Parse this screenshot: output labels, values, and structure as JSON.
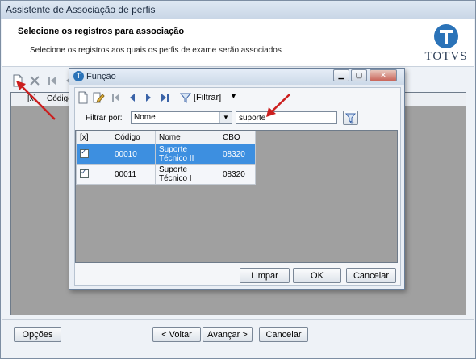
{
  "window": {
    "title": "Assistente de Associação de perfis"
  },
  "header": {
    "title": "Selecione os registros para associação",
    "subtitle": "Selecione os registros aos quais os perfis de exame serão associados",
    "logo_text": "TOTVS"
  },
  "outer_grid": {
    "col_check": "[x]",
    "col_code": "Código"
  },
  "footer": {
    "options_label": "Opções",
    "back_label": "< Voltar",
    "next_label": "Avançar >",
    "cancel_label": "Cancelar"
  },
  "dialog": {
    "title": "Função",
    "filter_menu_label": "[Filtrar]",
    "filter_by_label": "Filtrar por:",
    "filter_field_value": "Nome",
    "search_value": "suporte",
    "columns": [
      "[x]",
      "Código",
      "Nome",
      "CBO"
    ],
    "rows": [
      {
        "code": "00010",
        "name": "Suporte Técnico II",
        "cbo": "08320"
      },
      {
        "code": "00011",
        "name": "Suporte Técnico I",
        "cbo": "08320"
      }
    ],
    "clear_label": "Limpar",
    "ok_label": "OK",
    "cancel_label": "Cancelar"
  },
  "colors": {
    "selection": "#3d8fe0",
    "annotation_arrow": "#cc1f1f",
    "logo": "#2b73b8"
  }
}
